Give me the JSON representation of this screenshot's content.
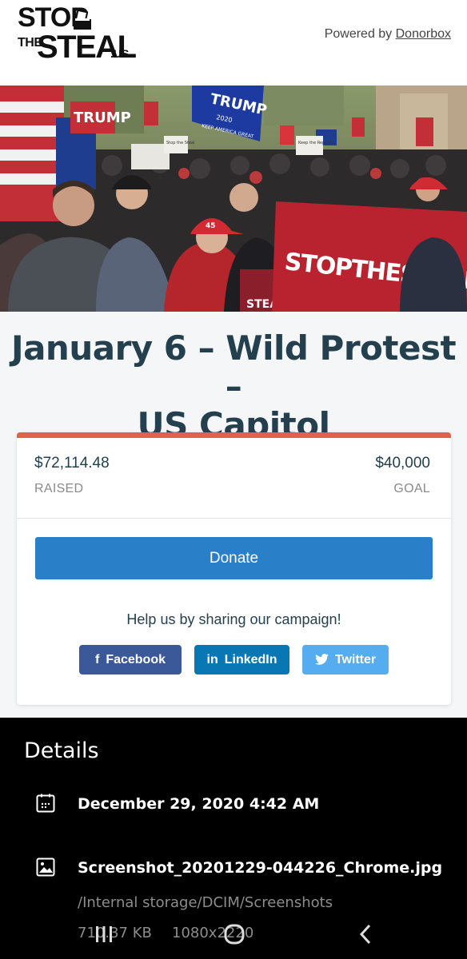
{
  "header": {
    "logo": {
      "stop": "STOP",
      "the": "THE",
      "steal": "STEAL",
      "us": ".US"
    },
    "powered_prefix": "Powered by ",
    "powered_link": "Donorbox"
  },
  "hero": {
    "sign_text": "STOPTHESTEAL.US",
    "sign_fragment": "STEAL",
    "flag_text": "TRUMP",
    "flag_year": "2020",
    "flag_slogan": "KEEP AMERICA GREAT",
    "small_sign": "Stop the Steal",
    "small_sign2": "Keep the Republic",
    "hat_text": "45"
  },
  "campaign": {
    "title_line1": "January 6 – Wild Protest –",
    "title_line2": "US Capitol",
    "raised_amount": "$72,114.48",
    "raised_label": "RAISED",
    "goal_amount": "$40,000",
    "goal_label": "GOAL",
    "progress_fraction": 1.0,
    "donate_label": "Donate",
    "share_text": "Help us by sharing our campaign!",
    "share": {
      "facebook": "Facebook",
      "linkedin": "LinkedIn",
      "twitter": "Twitter"
    },
    "colors": {
      "accent": "#e0604a",
      "button": "#2a7fc9",
      "title": "#24404f"
    }
  },
  "details": {
    "title": "Details",
    "date": "December 29, 2020 4:42 AM",
    "filename": "Screenshot_20201229-044226_Chrome.jpg",
    "path": "/Internal storage/DCIM/Screenshots",
    "size": "710.37 KB",
    "resolution": "1080x2220"
  },
  "icons": [
    "calendar-icon",
    "image-icon",
    "recents-icon",
    "home-icon",
    "back-icon",
    "facebook-icon",
    "linkedin-icon",
    "twitter-icon",
    "ballot-box-icon"
  ]
}
